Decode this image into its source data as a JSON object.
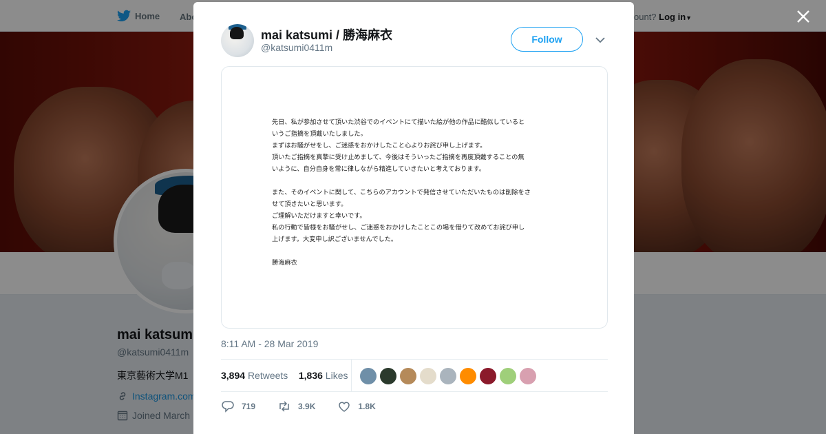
{
  "background": {
    "nav": {
      "home_label": "Home",
      "about_label": "Abo",
      "account_prompt": "ccount?",
      "login_label": "Log in"
    },
    "profile": {
      "name": "mai katsum",
      "handle": "@katsumi0411m",
      "bio": "東京藝術大学M1 ",
      "link": "Instagram.com",
      "joined": "Joined March"
    }
  },
  "tweet": {
    "display_name": "mai katsumi / 勝海麻衣",
    "handle": "@katsumi0411m",
    "follow_label": "Follow",
    "statement_lines": [
      "先日、私が参加させて頂いた渋谷でのイベントにて描いた絵が他の作品に酷似していると",
      "いうご指摘を頂戴いたしました。",
      "まずはお騒がせをし、ご迷惑をおかけしたこと心よりお詫び申し上げます。",
      "頂いたご指摘を真摯に受け止めまして、今後はそういったご指摘を再度頂戴することの無",
      "いように、自分自身を常に律しながら精進していきたいと考えております。",
      "",
      "また、そのイベントに関して、こちらのアカウントで発信させていただいたものは削除をさ",
      "せて頂きたいと思います。",
      "ご理解いただけますと幸いです。",
      "私の行動で皆様をお騒がせし、ご迷惑をおかけしたことこの場を借りて改めてお詫び申し",
      "上げます。大変申し訳ございませんでした。",
      "",
      "勝海麻衣"
    ],
    "timestamp": "8:11 AM - 28 Mar 2019",
    "retweets_count": "3,894",
    "retweets_label": "Retweets",
    "likes_count": "1,836",
    "likes_label": "Likes",
    "liker_colors": [
      "#6f8fa8",
      "#2b3a2c",
      "#b58a5a",
      "#e4dccb",
      "#aab4bd",
      "#ff8c00",
      "#8b1a2b",
      "#9fcf7a",
      "#d8a0b0"
    ],
    "reply_count": "719",
    "retweet_count_short": "3.9K",
    "like_count_short": "1.8K"
  },
  "colors": {
    "accent": "#1da1f2",
    "text": "#14171a",
    "muted": "#657786"
  }
}
